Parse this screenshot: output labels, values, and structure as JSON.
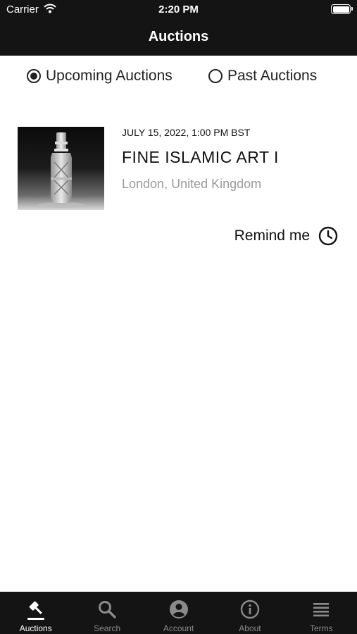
{
  "status_bar": {
    "carrier": "Carrier",
    "time": "2:20 PM"
  },
  "nav": {
    "title": "Auctions"
  },
  "filter": {
    "options": [
      {
        "label": "Upcoming Auctions",
        "selected": true
      },
      {
        "label": "Past Auctions",
        "selected": false
      }
    ]
  },
  "auctions": [
    {
      "date": "JULY 15, 2022, 1:00 PM BST",
      "title": "FINE ISLAMIC ART I",
      "location": "London, United Kingdom",
      "remind_label": "Remind me"
    }
  ],
  "tabs": [
    {
      "label": "Auctions",
      "icon": "gavel-icon",
      "active": true
    },
    {
      "label": "Search",
      "icon": "search-icon",
      "active": false
    },
    {
      "label": "Account",
      "icon": "account-icon",
      "active": false
    },
    {
      "label": "About",
      "icon": "info-icon",
      "active": false
    },
    {
      "label": "Terms",
      "icon": "list-icon",
      "active": false
    }
  ],
  "colors": {
    "bar_background": "#141414",
    "tab_active": "#ffffff",
    "tab_inactive": "#8a8a8a",
    "location_text": "#9a9a9a"
  }
}
